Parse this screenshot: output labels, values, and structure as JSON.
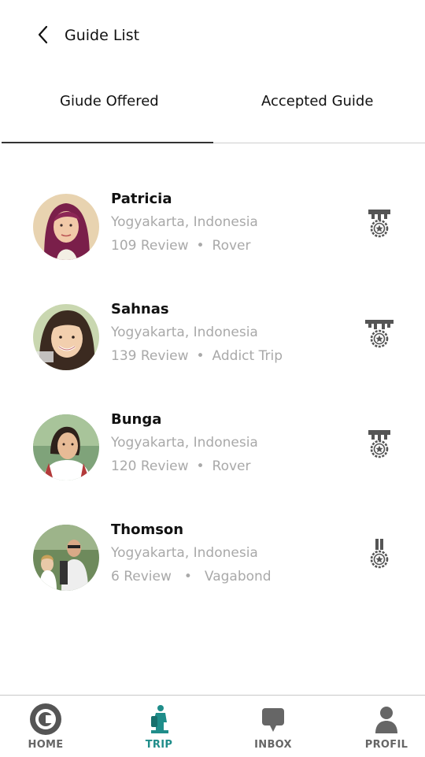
{
  "header": {
    "title": "Guide List"
  },
  "tabs": [
    {
      "label": "Giude Offered",
      "active": true
    },
    {
      "label": "Accepted Guide",
      "active": false
    }
  ],
  "guides": [
    {
      "name": "Patricia",
      "location": "Yogyakarta, Indonesia",
      "reviews": "109 Review",
      "rank": "Rover"
    },
    {
      "name": "Sahnas",
      "location": "Yogyakarta, Indonesia",
      "reviews": "139 Review",
      "rank": "Addict Trip"
    },
    {
      "name": "Bunga",
      "location": "Yogyakarta, Indonesia",
      "reviews": "120 Review",
      "rank": "Rover"
    },
    {
      "name": "Thomson",
      "location": "Yogyakarta, Indonesia",
      "reviews": "6 Review",
      "rank": "Vagabond"
    }
  ],
  "nav": [
    {
      "label": "HOME",
      "icon": "home-icon"
    },
    {
      "label": "TRIP",
      "icon": "trip-icon",
      "active": true
    },
    {
      "label": "INBOX",
      "icon": "inbox-icon"
    },
    {
      "label": "PROFIL",
      "icon": "profile-icon"
    }
  ],
  "colors": {
    "accent": "#1f8d8a",
    "muted_text": "#a9a9a9",
    "icon_gray": "#555555"
  }
}
